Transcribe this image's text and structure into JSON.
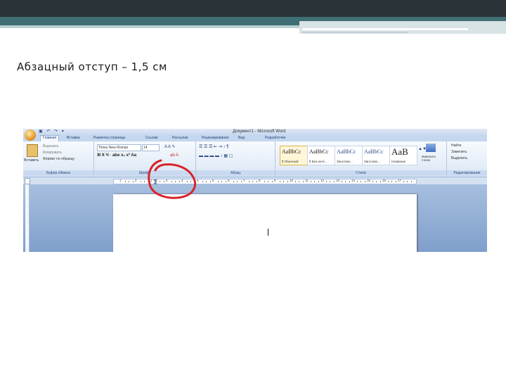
{
  "slide": {
    "title": "Абзацный отступ – 1,5 см"
  },
  "window": {
    "title": "Документ1 - Microsoft Word",
    "quick_access": "▣ ↶ ↷ ▾"
  },
  "tabs": [
    "Главная",
    "Вставка",
    "Разметка страницы",
    "Ссылки",
    "Рассылки",
    "Рецензирование",
    "Вид",
    "Разработчик"
  ],
  "ribbon": {
    "clipboard": {
      "paste": "Вставить",
      "cut": "Вырезать",
      "copy": "Копировать",
      "format_painter": "Формат по образцу",
      "label": "Буфер обмена"
    },
    "font": {
      "name": "Times New Roman",
      "size": "14",
      "label": "Шрифт"
    },
    "paragraph": {
      "label": "Абзац"
    },
    "styles": {
      "items": [
        {
          "sample": "AaBbCc",
          "name": "¶ Обычный"
        },
        {
          "sample": "AaBbCc",
          "name": "¶ Без инте..."
        },
        {
          "sample": "AaBbCc",
          "name": "Заголово..."
        },
        {
          "sample": "AaBbCc",
          "name": "Заголово..."
        },
        {
          "sample": "AaB",
          "name": "Название"
        }
      ],
      "change_styles": "Изменить стили",
      "label": "Стили"
    },
    "editing": {
      "find": "Найти",
      "replace": "Заменить",
      "select": "Выделить",
      "label": "Редактирование"
    }
  },
  "ruler": {
    "numbers": [
      "1",
      "2",
      "1",
      "2",
      "3",
      "4",
      "5",
      "6",
      "7",
      "8",
      "9",
      "10",
      "11",
      "12",
      "13",
      "14",
      "15",
      "16",
      "17"
    ]
  },
  "colors": {
    "annotation_circle": "#d8232a",
    "ribbon_blue": "#c4d7ee",
    "header_dark": "#2a3338",
    "header_teal": "#3f6f74"
  }
}
